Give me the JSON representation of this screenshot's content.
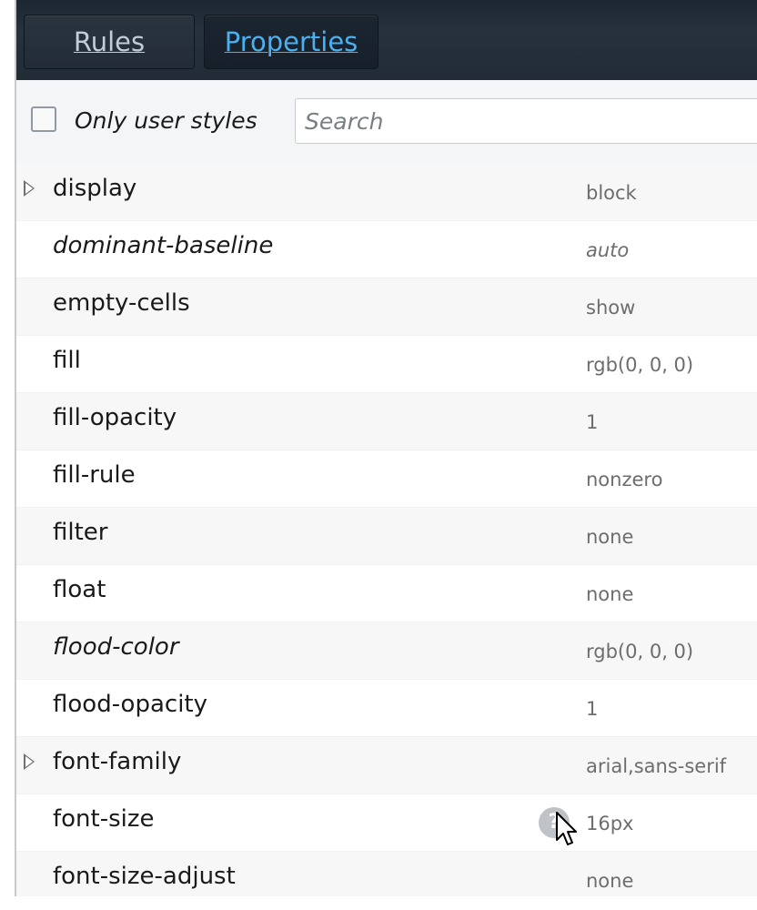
{
  "tabs": {
    "rules_label": "Rules",
    "properties_label": "Properties"
  },
  "filter": {
    "only_user_styles_label": "Only user styles",
    "only_user_styles_checked": false,
    "search_placeholder": "Search"
  },
  "properties": [
    {
      "name": "display",
      "value": "block"
    },
    {
      "name": "dominant-baseline",
      "value": "auto"
    },
    {
      "name": "empty-cells",
      "value": "show"
    },
    {
      "name": "fill",
      "value": "rgb(0, 0, 0)"
    },
    {
      "name": "fill-opacity",
      "value": "1"
    },
    {
      "name": "fill-rule",
      "value": "nonzero"
    },
    {
      "name": "filter",
      "value": "none"
    },
    {
      "name": "float",
      "value": "none"
    },
    {
      "name": "flood-color",
      "value": "rgb(0, 0, 0)"
    },
    {
      "name": "flood-opacity",
      "value": "1"
    },
    {
      "name": "font-family",
      "value": "arial,sans-serif"
    },
    {
      "name": "font-size",
      "value": "16px"
    },
    {
      "name": "font-size-adjust",
      "value": "none"
    }
  ],
  "colors": {
    "active_tab_text": "#4ab0f0",
    "inactive_tab_text": "#c2ccd6",
    "tabbar_bg": "#222c36",
    "value_text": "#6d6d6d"
  },
  "icons": {
    "expand": "triangle-right",
    "help": "question-circle",
    "pointer": "arrow-cursor"
  }
}
